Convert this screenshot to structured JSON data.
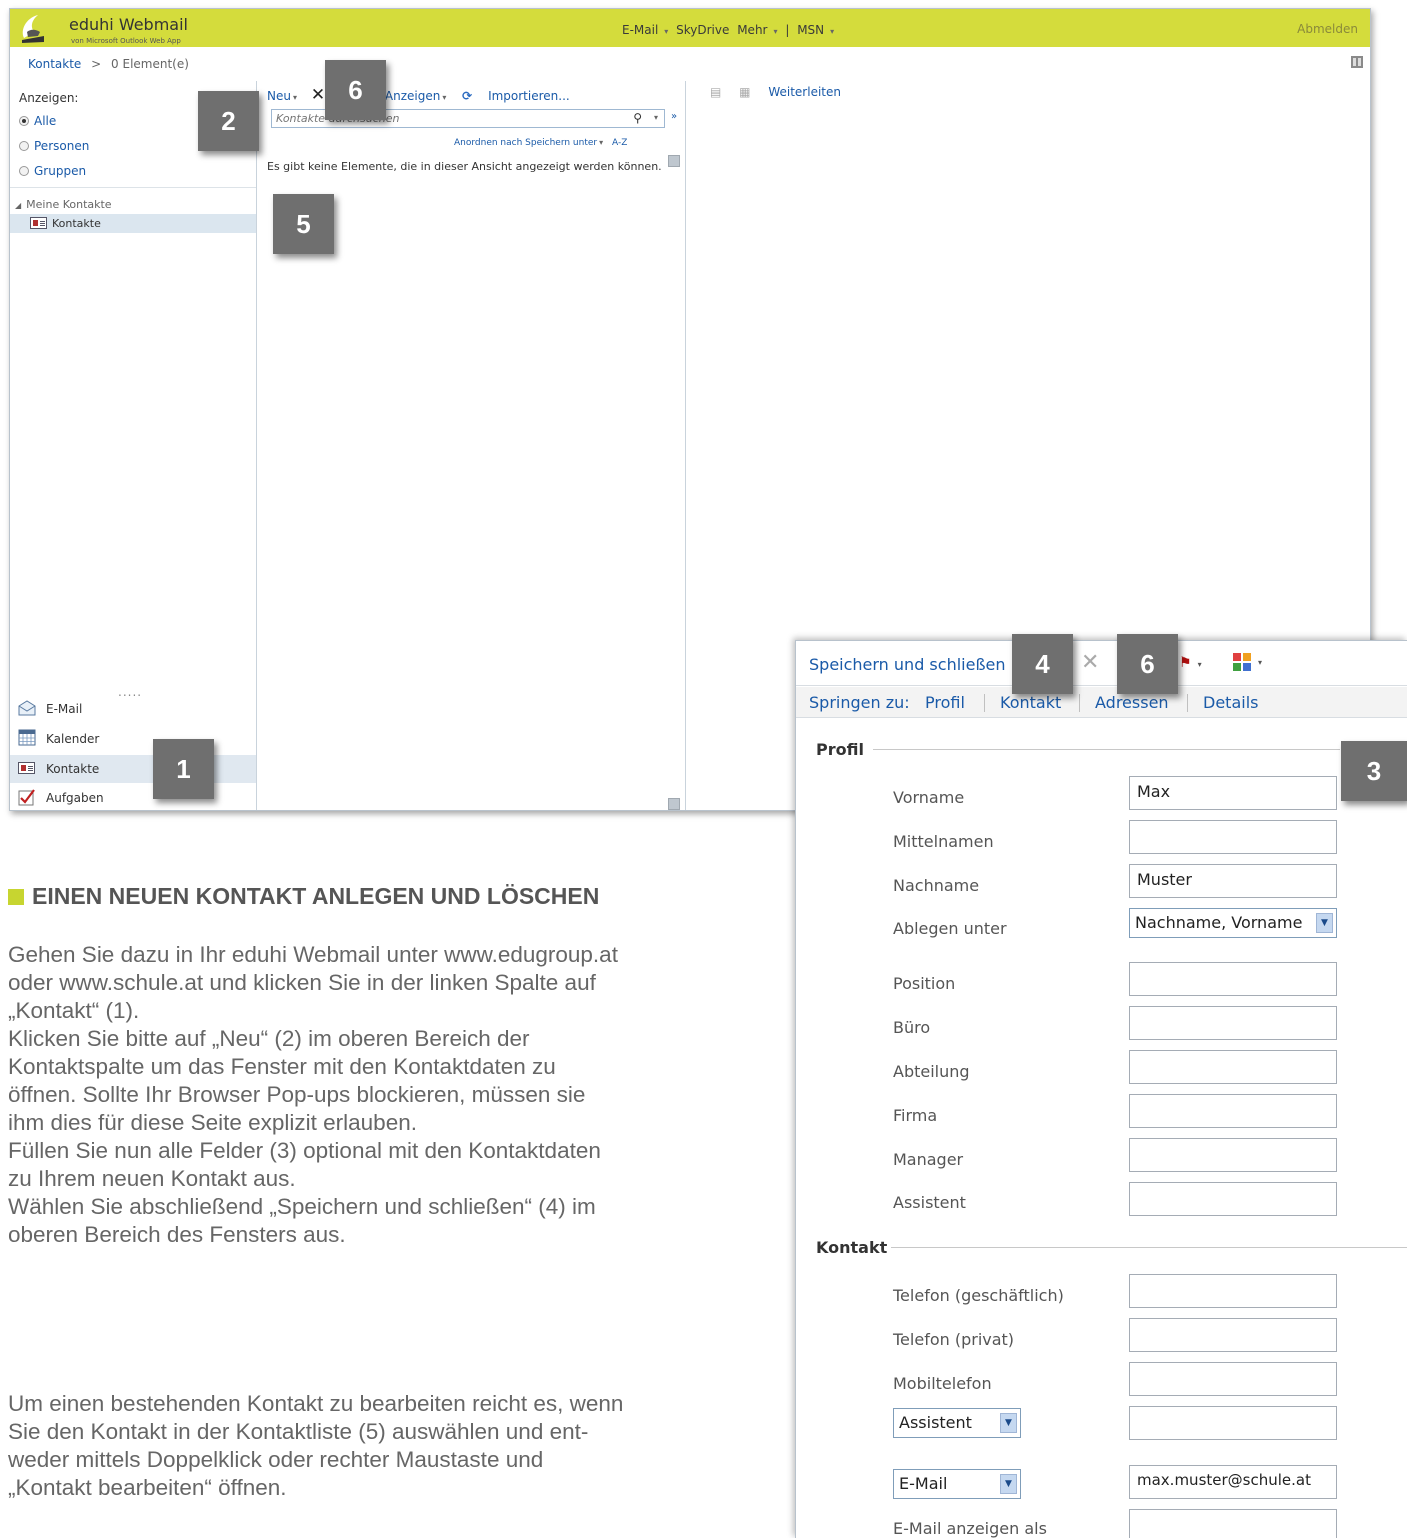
{
  "owa": {
    "app_title": "eduhi Webmail",
    "app_subtitle": "von Microsoft Outlook Web App",
    "top_nav": [
      "E-Mail",
      "SkyDrive",
      "Mehr",
      "|",
      "MSN"
    ],
    "logout": "Abmelden",
    "breadcrumb_folder": "Kontakte",
    "breadcrumb_sep": ">",
    "breadcrumb_count": "0 Element(e)",
    "show_label": "Anzeigen:",
    "filter_options": [
      "Alle",
      "Personen",
      "Gruppen"
    ],
    "filter_selected": "Alle",
    "my_contacts_label": "Meine Kontakte",
    "my_contacts_item": "Kontakte",
    "more_dots": ".....",
    "nav_items": [
      "E-Mail",
      "Kalender",
      "Kontakte",
      "Aufgaben"
    ],
    "nav_selected": "Kontakte",
    "toolbar": {
      "new": "Neu",
      "view": "Anzeigen",
      "import": "Importieren..."
    },
    "search_placeholder": "Kontakte durchsuchen",
    "arrange": "Anordnen nach Speichern unter",
    "arrange_order": "A-Z",
    "empty_message": "Es gibt keine Elemente, die in dieser Ansicht angezeigt werden können.",
    "reading_toolbar": {
      "forward": "Weiterleiten"
    }
  },
  "form": {
    "save_close": "Speichern und schließen",
    "jump_label": "Springen zu:",
    "jump_links": [
      "Profil",
      "Kontakt",
      "Adressen",
      "Details"
    ],
    "section_profile": "Profil",
    "section_contact": "Kontakt",
    "fields": {
      "first_name": {
        "label": "Vorname",
        "value": "Max"
      },
      "middle_name": {
        "label": "Mittelnamen",
        "value": ""
      },
      "last_name": {
        "label": "Nachname",
        "value": "Muster"
      },
      "file_as": {
        "label": "Ablegen unter",
        "value": "Nachname, Vorname"
      },
      "position": {
        "label": "Position",
        "value": ""
      },
      "office": {
        "label": "Büro",
        "value": ""
      },
      "department": {
        "label": "Abteilung",
        "value": ""
      },
      "company": {
        "label": "Firma",
        "value": ""
      },
      "manager": {
        "label": "Manager",
        "value": ""
      },
      "assistant": {
        "label": "Assistent",
        "value": ""
      },
      "phone_business": {
        "label": "Telefon (geschäftlich)",
        "value": ""
      },
      "phone_private": {
        "label": "Telefon (privat)",
        "value": ""
      },
      "mobile": {
        "label": "Mobiltelefon",
        "value": ""
      },
      "phone_type_select": {
        "value": "Assistent"
      },
      "phone_extra": {
        "value": ""
      },
      "email_type_select": {
        "value": "E-Mail"
      },
      "email": {
        "value": "max.muster@schule.at"
      },
      "email_display": {
        "label": "E-Mail anzeigen als",
        "value": ""
      }
    }
  },
  "badges": {
    "b1": "1",
    "b2": "2",
    "b3": "3",
    "b4": "4",
    "b5": "5",
    "b6a": "6",
    "b6b": "6"
  },
  "doc": {
    "heading": "EINEN NEUEN KONTAKT ANLEGEN UND LÖSCHEN",
    "para1_lines": [
      "Gehen Sie dazu in Ihr eduhi Webmail unter www.edugroup.at",
      "oder www.schule.at und klicken Sie in der linken Spalte auf",
      "„Kontakt“ (1).",
      "Klicken Sie bitte auf „Neu“ (2) im oberen Bereich der",
      "Kontaktspalte um das Fenster mit den Kontaktdaten zu",
      "öffnen. Sollte Ihr Browser Pop-ups blockieren, müssen sie",
      "ihm dies für diese Seite explizit erlauben.",
      "Füllen Sie nun alle Felder (3) optional mit den Kontaktdaten",
      "zu Ihrem neuen Kontakt aus.",
      "Wählen Sie abschließend „Speichern und schließen“ (4) im",
      "oberen Bereich des Fensters aus."
    ],
    "para2_lines": [
      "Um einen bestehenden Kontakt zu bearbeiten reicht es, wenn",
      "Sie den Kontakt in der Kontaktliste (5) auswählen und ent-",
      "weder mittels Doppelklick oder rechter Maustaste und",
      "„Kontakt bearbeiten“ öffnen."
    ]
  },
  "colors": {
    "topbar": "#d4dc3c",
    "link": "#1a5aa8",
    "badge": "#6f6f6f",
    "heading_square": "#c7d530"
  }
}
